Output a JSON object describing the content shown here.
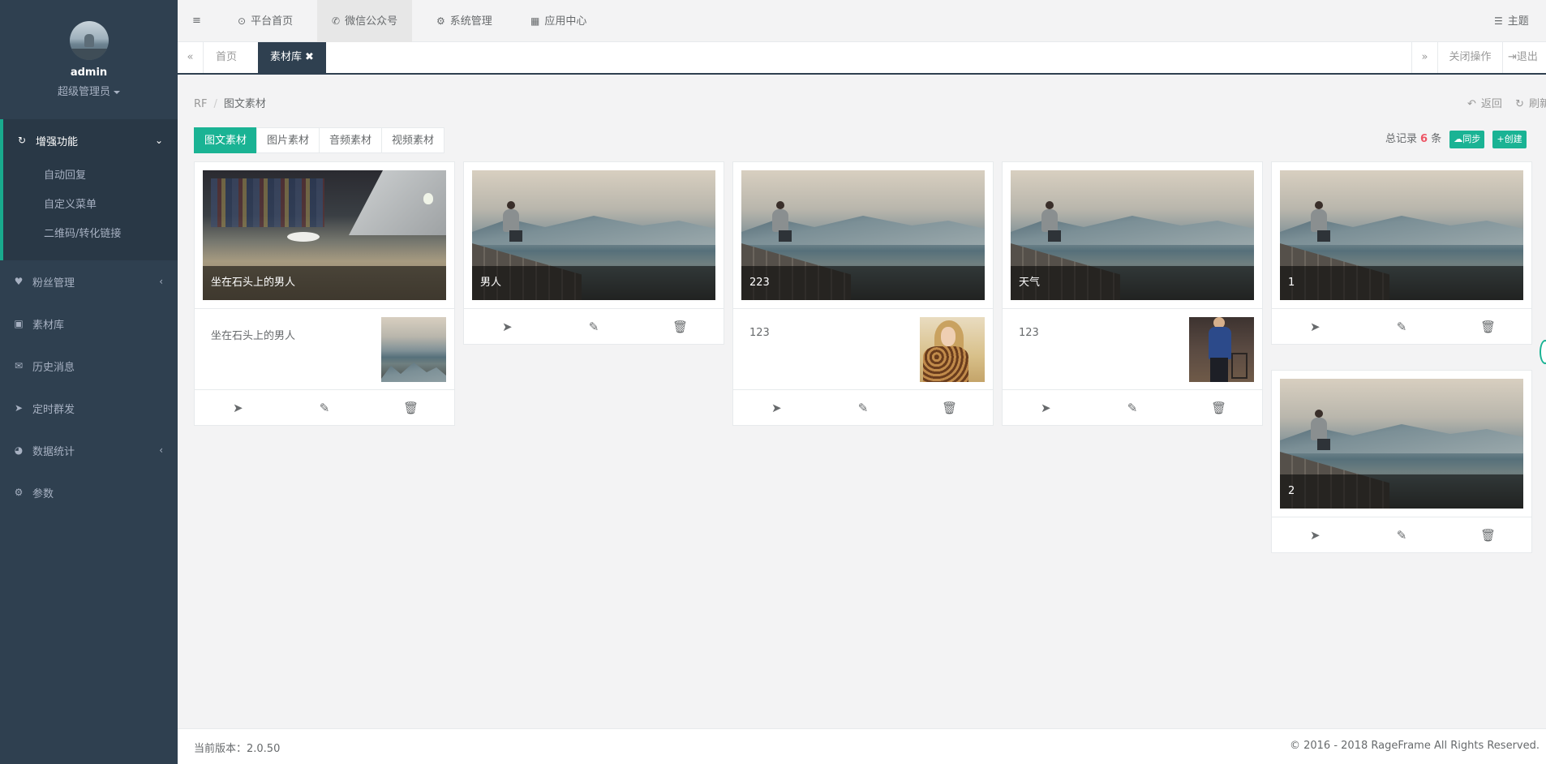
{
  "sidebar": {
    "user_name": "admin",
    "user_role": "超级管理员",
    "active_section": {
      "label": "增强功能",
      "icon": "refresh-icon"
    },
    "sub_items": [
      "自动回复",
      "自定义菜单",
      "二维码/转化链接"
    ],
    "items": [
      {
        "label": "粉丝管理",
        "icon": "heart-icon",
        "has_arrow": true
      },
      {
        "label": "素材库",
        "icon": "image-icon",
        "has_arrow": false
      },
      {
        "label": "历史消息",
        "icon": "comments-icon",
        "has_arrow": false
      },
      {
        "label": "定时群发",
        "icon": "send-icon",
        "has_arrow": false
      },
      {
        "label": "数据统计",
        "icon": "pie-chart-icon",
        "has_arrow": true
      },
      {
        "label": "参数",
        "icon": "gear-icon",
        "has_arrow": false
      }
    ]
  },
  "topbar": {
    "menu_items": [
      {
        "label": "平台首页",
        "icon": "dot-circle-icon"
      },
      {
        "label": "微信公众号",
        "icon": "wechat-icon",
        "active": true
      },
      {
        "label": "系统管理",
        "icon": "cogs-icon"
      },
      {
        "label": "应用中心",
        "icon": "grid-icon"
      }
    ],
    "theme_label": "主题"
  },
  "tabbar": {
    "tabs": [
      {
        "label": "首页",
        "active": false
      },
      {
        "label": "素材库",
        "active": true
      }
    ],
    "close_ops_label": "关闭操作",
    "logout_label": "退出"
  },
  "content": {
    "breadcrumb": {
      "root": "RF",
      "current": "图文素材"
    },
    "back_label": "返回",
    "refresh_label": "刷新",
    "material_tabs": [
      {
        "label": "图文素材",
        "active": true
      },
      {
        "label": "图片素材",
        "active": false
      },
      {
        "label": "音频素材",
        "active": false
      },
      {
        "label": "视频素材",
        "active": false
      }
    ],
    "stats": {
      "prefix": "总记录",
      "count": "6",
      "suffix": "条"
    },
    "sync_label": "同步",
    "create_label": "创建",
    "cards": [
      {
        "caption": "坐在石头上的男人",
        "scene": "desk",
        "sub": {
          "title": "坐在石头上的男人",
          "thumb": "mountain"
        }
      },
      {
        "caption": "男人",
        "scene": "mountain",
        "sub": null
      },
      {
        "caption": "223",
        "scene": "mountain",
        "sub": {
          "title": "123",
          "thumb": "woman"
        }
      },
      {
        "caption": "天气",
        "scene": "mountain",
        "sub": {
          "title": "123",
          "thumb": "man2"
        }
      },
      {
        "caption": "1",
        "scene": "mountain",
        "sub": null
      },
      {
        "caption": "2",
        "scene": "mountain",
        "sub": null
      }
    ]
  },
  "footer": {
    "version_label": "当前版本：2.0.50",
    "copyright": "© 2016 - 2018 RageFrame All Rights Reserved."
  },
  "colors": {
    "sidebar_bg": "#2f4050",
    "accent": "#1ab394",
    "count_red": "#ed5565"
  }
}
